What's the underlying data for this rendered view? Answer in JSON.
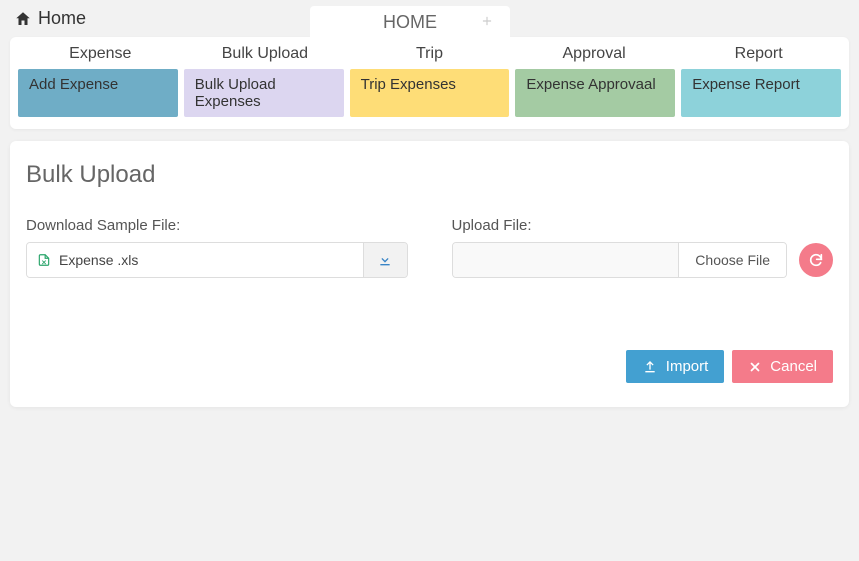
{
  "breadcrumb": {
    "home_label": "Home"
  },
  "tabs": {
    "current": "HOME"
  },
  "categories": [
    {
      "label": "Expense"
    },
    {
      "label": "Bulk Upload"
    },
    {
      "label": "Trip"
    },
    {
      "label": "Approval"
    },
    {
      "label": "Report"
    }
  ],
  "category_buttons": [
    {
      "label": "Add Expense"
    },
    {
      "label": "Bulk Upload Expenses"
    },
    {
      "label": "Trip Expenses"
    },
    {
      "label": "Expense Approvaal"
    },
    {
      "label": "Expense Report"
    }
  ],
  "page": {
    "title": "Bulk Upload",
    "download_label": "Download Sample File:",
    "sample_file_name": "Expense .xls",
    "upload_label": "Upload File:",
    "choose_file_label": "Choose File",
    "import_label": "Import",
    "cancel_label": "Cancel"
  }
}
